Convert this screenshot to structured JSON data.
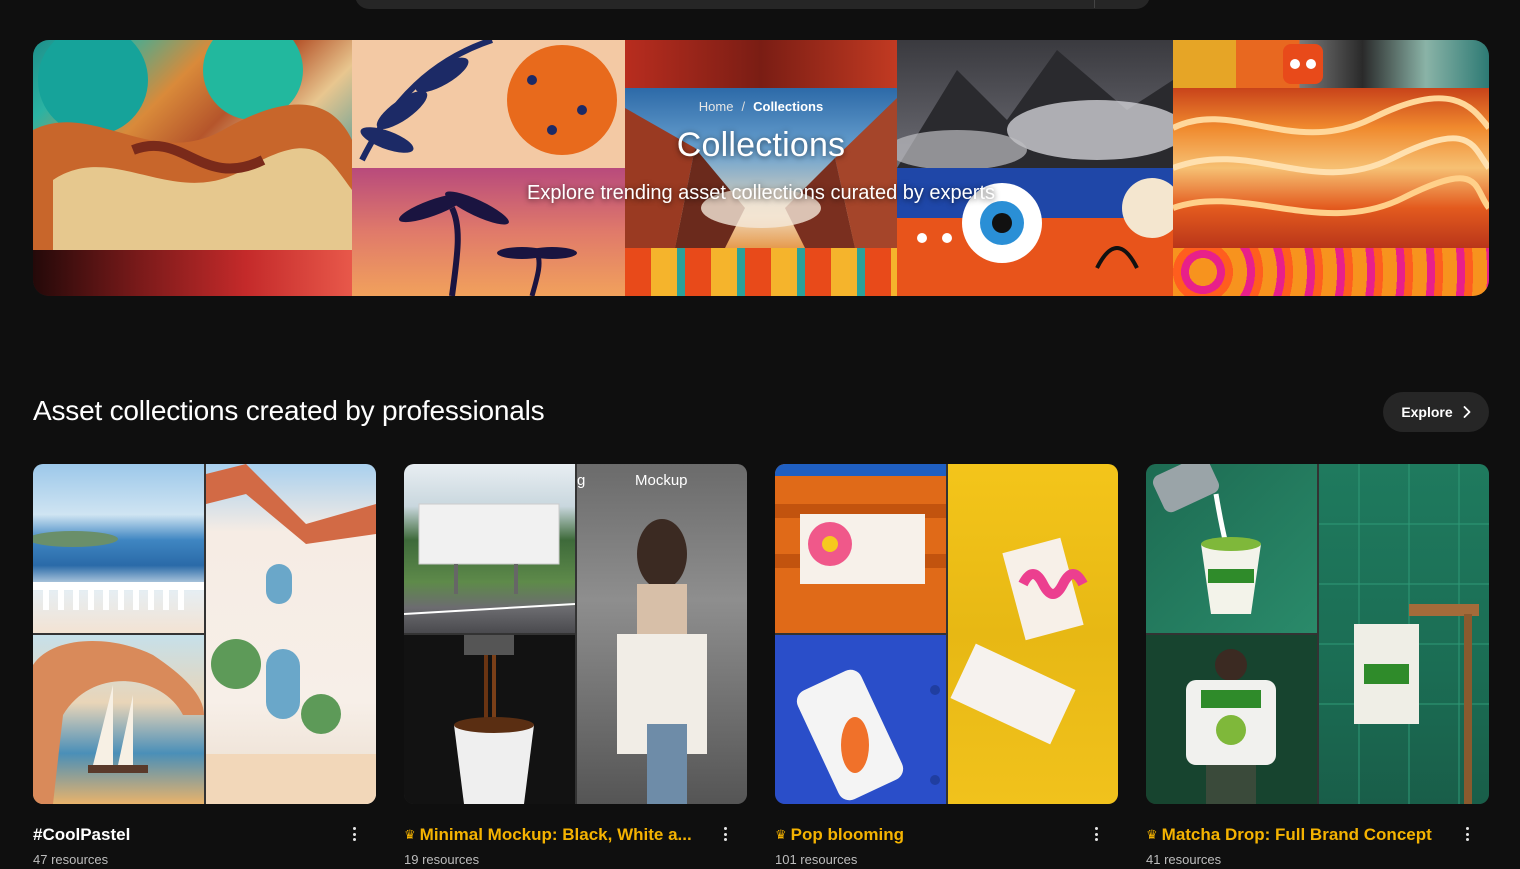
{
  "breadcrumb": {
    "home": "Home",
    "separator": "/",
    "current": "Collections"
  },
  "hero": {
    "title": "Collections",
    "subtitle": "Explore trending asset collections curated by experts"
  },
  "section": {
    "title": "Asset collections created by professionals",
    "explore_label": "Explore"
  },
  "cards": [
    {
      "title": "#CoolPastel",
      "count": "47 resources",
      "premium": false
    },
    {
      "title": "Minimal Mockup: Black, White a...",
      "count": "19 resources",
      "premium": true,
      "overlay_text": "Mockup",
      "overlay_partial": "g"
    },
    {
      "title": "Pop blooming",
      "count": "101 resources",
      "premium": true
    },
    {
      "title": "Matcha Drop: Full Brand Concept",
      "count": "41 resources",
      "premium": true
    }
  ],
  "colors": {
    "background": "#0f0f0f",
    "premium_accent": "#f5b301",
    "button_bg": "#262626"
  },
  "icons": {
    "crown": "crown-icon",
    "chevron": "chevron-right-icon",
    "kebab": "more-vertical-icon"
  }
}
